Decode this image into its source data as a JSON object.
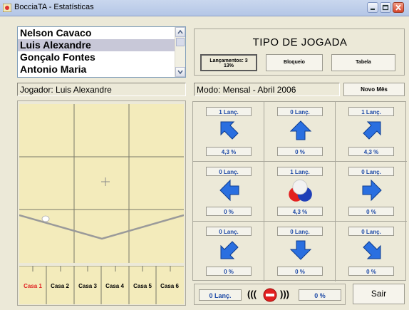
{
  "window": {
    "title": "BocciaTA - Estatísticas",
    "app_icon": "boccia-app-icon",
    "controls": [
      "minimize-icon",
      "maximize-icon",
      "close-icon"
    ]
  },
  "players": {
    "items": [
      "Nelson Cavaco",
      "Luis Alexandre",
      "Gonçalo Fontes",
      "Antonio Maria"
    ],
    "selected_index": 1
  },
  "jogador_label": "Jogador: Luis Alexandre",
  "court": {
    "center_mark": "+",
    "casas": [
      "Casa 1",
      "Casa 2",
      "Casa 3",
      "Casa 4",
      "Casa 5",
      "Casa 6"
    ],
    "active_casa": "Casa 1"
  },
  "tipo": {
    "title": "TIPO DE JOGADA",
    "buttons": [
      {
        "line1": "Lançamentos: 3",
        "line2": "13%"
      },
      {
        "line1": "Bloqueio"
      },
      {
        "line1": "Tabela"
      }
    ]
  },
  "modo_label": "Modo: Mensal - Abril 2006",
  "novo_mes_label": "Novo Mês",
  "cells": [
    {
      "lanc": "1 Lanç.",
      "pct": "4,3 %",
      "icon": "arrow-up-left-icon"
    },
    {
      "lanc": "0 Lanç.",
      "pct": "0 %",
      "icon": "arrow-up-icon"
    },
    {
      "lanc": "1 Lanç.",
      "pct": "4,3 %",
      "icon": "arrow-up-right-icon"
    },
    {
      "lanc": "0 Lanç.",
      "pct": "0 %",
      "icon": "arrow-left-icon"
    },
    {
      "lanc": "1 Lanç.",
      "pct": "4,3 %",
      "icon": "balls-icon"
    },
    {
      "lanc": "0 Lanç.",
      "pct": "0 %",
      "icon": "arrow-right-icon"
    },
    {
      "lanc": "0 Lanç.",
      "pct": "0 %",
      "icon": "arrow-down-left-icon"
    },
    {
      "lanc": "0 Lanç.",
      "pct": "0 %",
      "icon": "arrow-down-icon"
    },
    {
      "lanc": "0 Lanç.",
      "pct": "0 %",
      "icon": "arrow-down-right-icon"
    }
  ],
  "bottom": {
    "lanc": "0 Lanç.",
    "pct": "0 %",
    "paren_left": "(((",
    "paren_right": ")))",
    "icon": "no-entry-icon"
  },
  "sair_label": "Sair",
  "colors": {
    "window_bg": "#ece9d8",
    "court_fill": "#f3ebbb",
    "arrow_blue": "#2a6fe0",
    "value_blue": "#1e4aa6",
    "casa_active_red": "#e02020"
  }
}
